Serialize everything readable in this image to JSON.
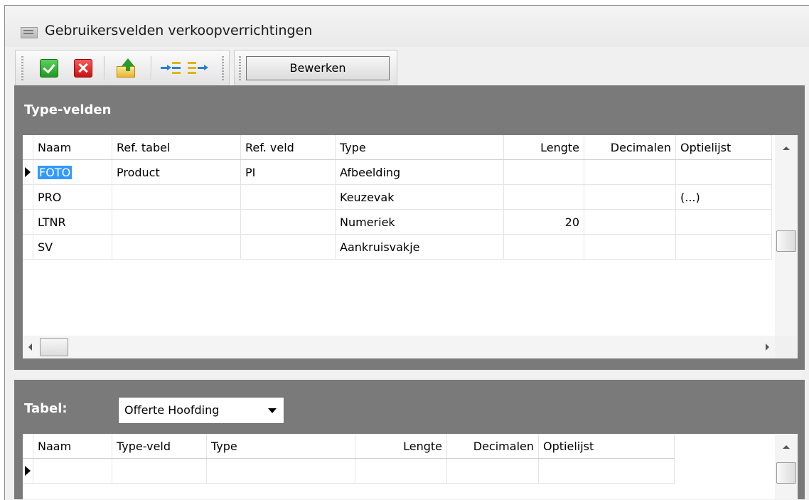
{
  "window": {
    "title": "Gebruikersvelden verkoopverrichtingen"
  },
  "toolbar": {
    "edit_label": "Bewerken"
  },
  "type_panel": {
    "title": "Type-velden",
    "columns": [
      "Naam",
      "Ref. tabel",
      "Ref. veld",
      "Type",
      "Lengte",
      "Decimalen",
      "Optielijst"
    ],
    "rows": [
      {
        "naam": "FOTO",
        "ref_tabel": "Product",
        "ref_veld": "PI",
        "type": "Afbeelding",
        "lengte": "",
        "decimalen": "",
        "optielijst": ""
      },
      {
        "naam": "PRO",
        "ref_tabel": "",
        "ref_veld": "",
        "type": "Keuzevak",
        "lengte": "",
        "decimalen": "",
        "optielijst": "(...)"
      },
      {
        "naam": "LTNR",
        "ref_tabel": "",
        "ref_veld": "",
        "type": "Numeriek",
        "lengte": "20",
        "decimalen": "",
        "optielijst": ""
      },
      {
        "naam": "SV",
        "ref_tabel": "",
        "ref_veld": "",
        "type": "Aankruisvakje",
        "lengte": "",
        "decimalen": "",
        "optielijst": ""
      }
    ]
  },
  "tabel_panel": {
    "label": "Tabel:",
    "selected": "Offerte Hoofding",
    "columns": [
      "Naam",
      "Type-veld",
      "Type",
      "Lengte",
      "Decimalen",
      "Optielijst"
    ]
  },
  "icons": [
    "window-icon",
    "confirm-check-icon",
    "cancel-x-icon",
    "export-arrow-icon",
    "insert-column-icon",
    "append-column-icon"
  ]
}
